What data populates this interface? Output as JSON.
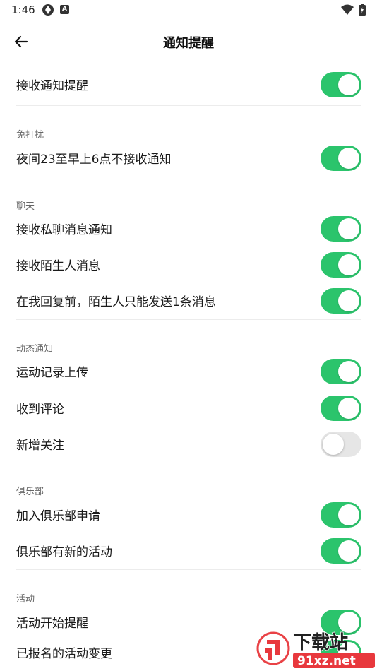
{
  "status_bar": {
    "time": "1:46",
    "badge_letter": "A"
  },
  "header": {
    "title": "通知提醒"
  },
  "settings": {
    "main": {
      "label": "接收通知提醒",
      "enabled": true
    },
    "dnd": {
      "title": "免打扰",
      "items": [
        {
          "label": "夜间23至早上6点不接收通知",
          "enabled": true
        }
      ]
    },
    "chat": {
      "title": "聊天",
      "items": [
        {
          "label": "接收私聊消息通知",
          "enabled": true
        },
        {
          "label": "接收陌生人消息",
          "enabled": true
        },
        {
          "label": "在我回复前，陌生人只能发送1条消息",
          "enabled": true
        }
      ]
    },
    "activity_notify": {
      "title": "动态通知",
      "items": [
        {
          "label": "运动记录上传",
          "enabled": true
        },
        {
          "label": "收到评论",
          "enabled": true
        },
        {
          "label": "新增关注",
          "enabled": false
        }
      ]
    },
    "club": {
      "title": "俱乐部",
      "items": [
        {
          "label": "加入俱乐部申请",
          "enabled": true
        },
        {
          "label": "俱乐部有新的活动",
          "enabled": true
        }
      ]
    },
    "events": {
      "title": "活动",
      "items": [
        {
          "label": "活动开始提醒",
          "enabled": true
        },
        {
          "label": "已报名的活动变更",
          "enabled": true
        }
      ]
    }
  },
  "watermark": {
    "line1": "下载站",
    "line2": "91xz.net"
  },
  "colors": {
    "toggle_on": "#2bc46c",
    "toggle_off": "#e6e6e6",
    "watermark_red": "#e8383d"
  }
}
